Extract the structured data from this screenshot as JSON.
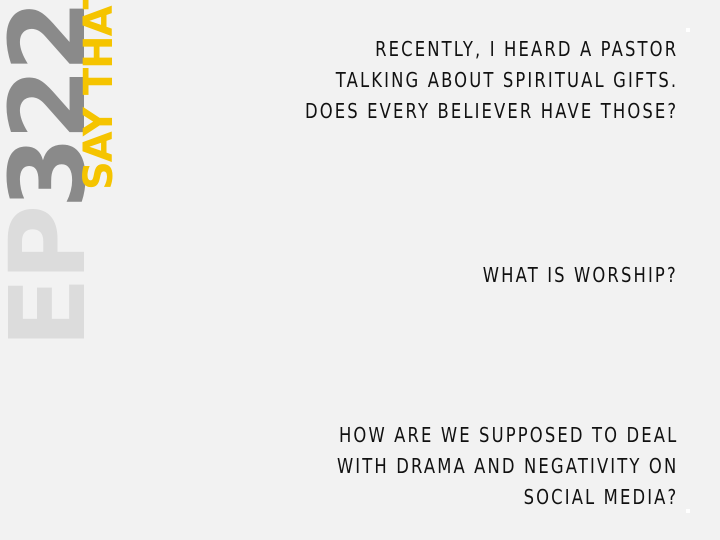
{
  "title": {
    "episode_prefix": "EP",
    "episode_number": "322",
    "show_name": "SAY THAT!",
    "colors": {
      "ep_prefix": "#dcdcdc",
      "episode_number": "#8a8a8a",
      "show_name": "#f5c400"
    }
  },
  "questions": [
    {
      "lines": [
        "RECENTLY, I HEARD A PASTOR",
        "TALKING ABOUT SPIRITUAL GIFTS.",
        "DOES EVERY BELIEVER HAVE THOSE?"
      ]
    },
    {
      "lines": [
        "WHAT IS WORSHIP?"
      ]
    },
    {
      "lines": [
        "HOW ARE WE SUPPOSED TO DEAL",
        "WITH DRAMA AND NEGATIVITY ON",
        "SOCIAL MEDIA?"
      ]
    }
  ]
}
